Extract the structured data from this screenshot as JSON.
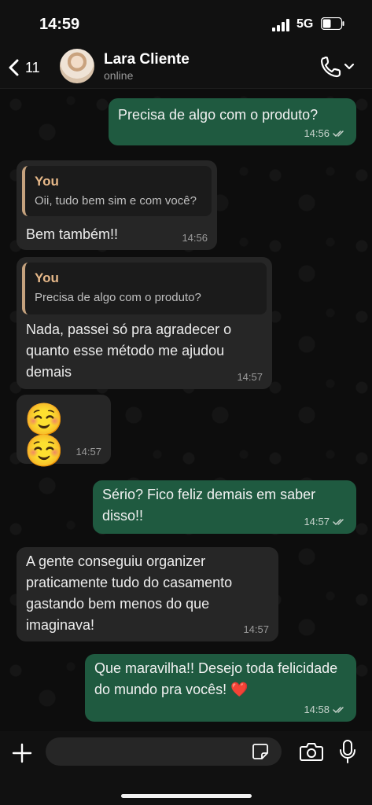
{
  "status_bar": {
    "time": "14:59",
    "network": "5G"
  },
  "header": {
    "back_count": "11",
    "contact_name": "Lara Cliente",
    "contact_status": "online",
    "icons": {
      "back": "chevron-left-icon",
      "call": "phone-icon"
    }
  },
  "messages": [
    {
      "direction": "out",
      "text": "Precisa de algo com o produto?",
      "time": "14:56",
      "read": true
    },
    {
      "direction": "in",
      "quote_author": "You",
      "quote_text": "Oii, tudo bem sim e com você?",
      "text": "Bem também!!",
      "time": "14:56"
    },
    {
      "direction": "in",
      "quote_author": "You",
      "quote_text": "Precisa de algo com o produto?",
      "text": "Nada, passei só pra agradecer o quanto esse método me ajudou demais",
      "time": "14:57"
    },
    {
      "direction": "in",
      "text": "☺️ ☺️",
      "time": "14:57"
    },
    {
      "direction": "out",
      "text": "Sério? Fico feliz demais em saber disso!!",
      "time": "14:57",
      "read": true
    },
    {
      "direction": "in",
      "text": "A gente conseguiu organizer praticamente tudo do casamento gastando bem menos do que imaginava!",
      "time": "14:57"
    },
    {
      "direction": "out",
      "text": "Que maravilha!! Desejo toda felicidade do mundo pra vocês! ❤️",
      "time": "14:58",
      "read": true
    }
  ],
  "input_bar": {
    "placeholder": "",
    "icons": [
      "plus-icon",
      "sticker-icon",
      "camera-icon",
      "microphone-icon"
    ]
  },
  "colors": {
    "outgoing_bubble": "#1f5a40",
    "incoming_bubble": "#262626",
    "quote_author": "#e6b889"
  }
}
